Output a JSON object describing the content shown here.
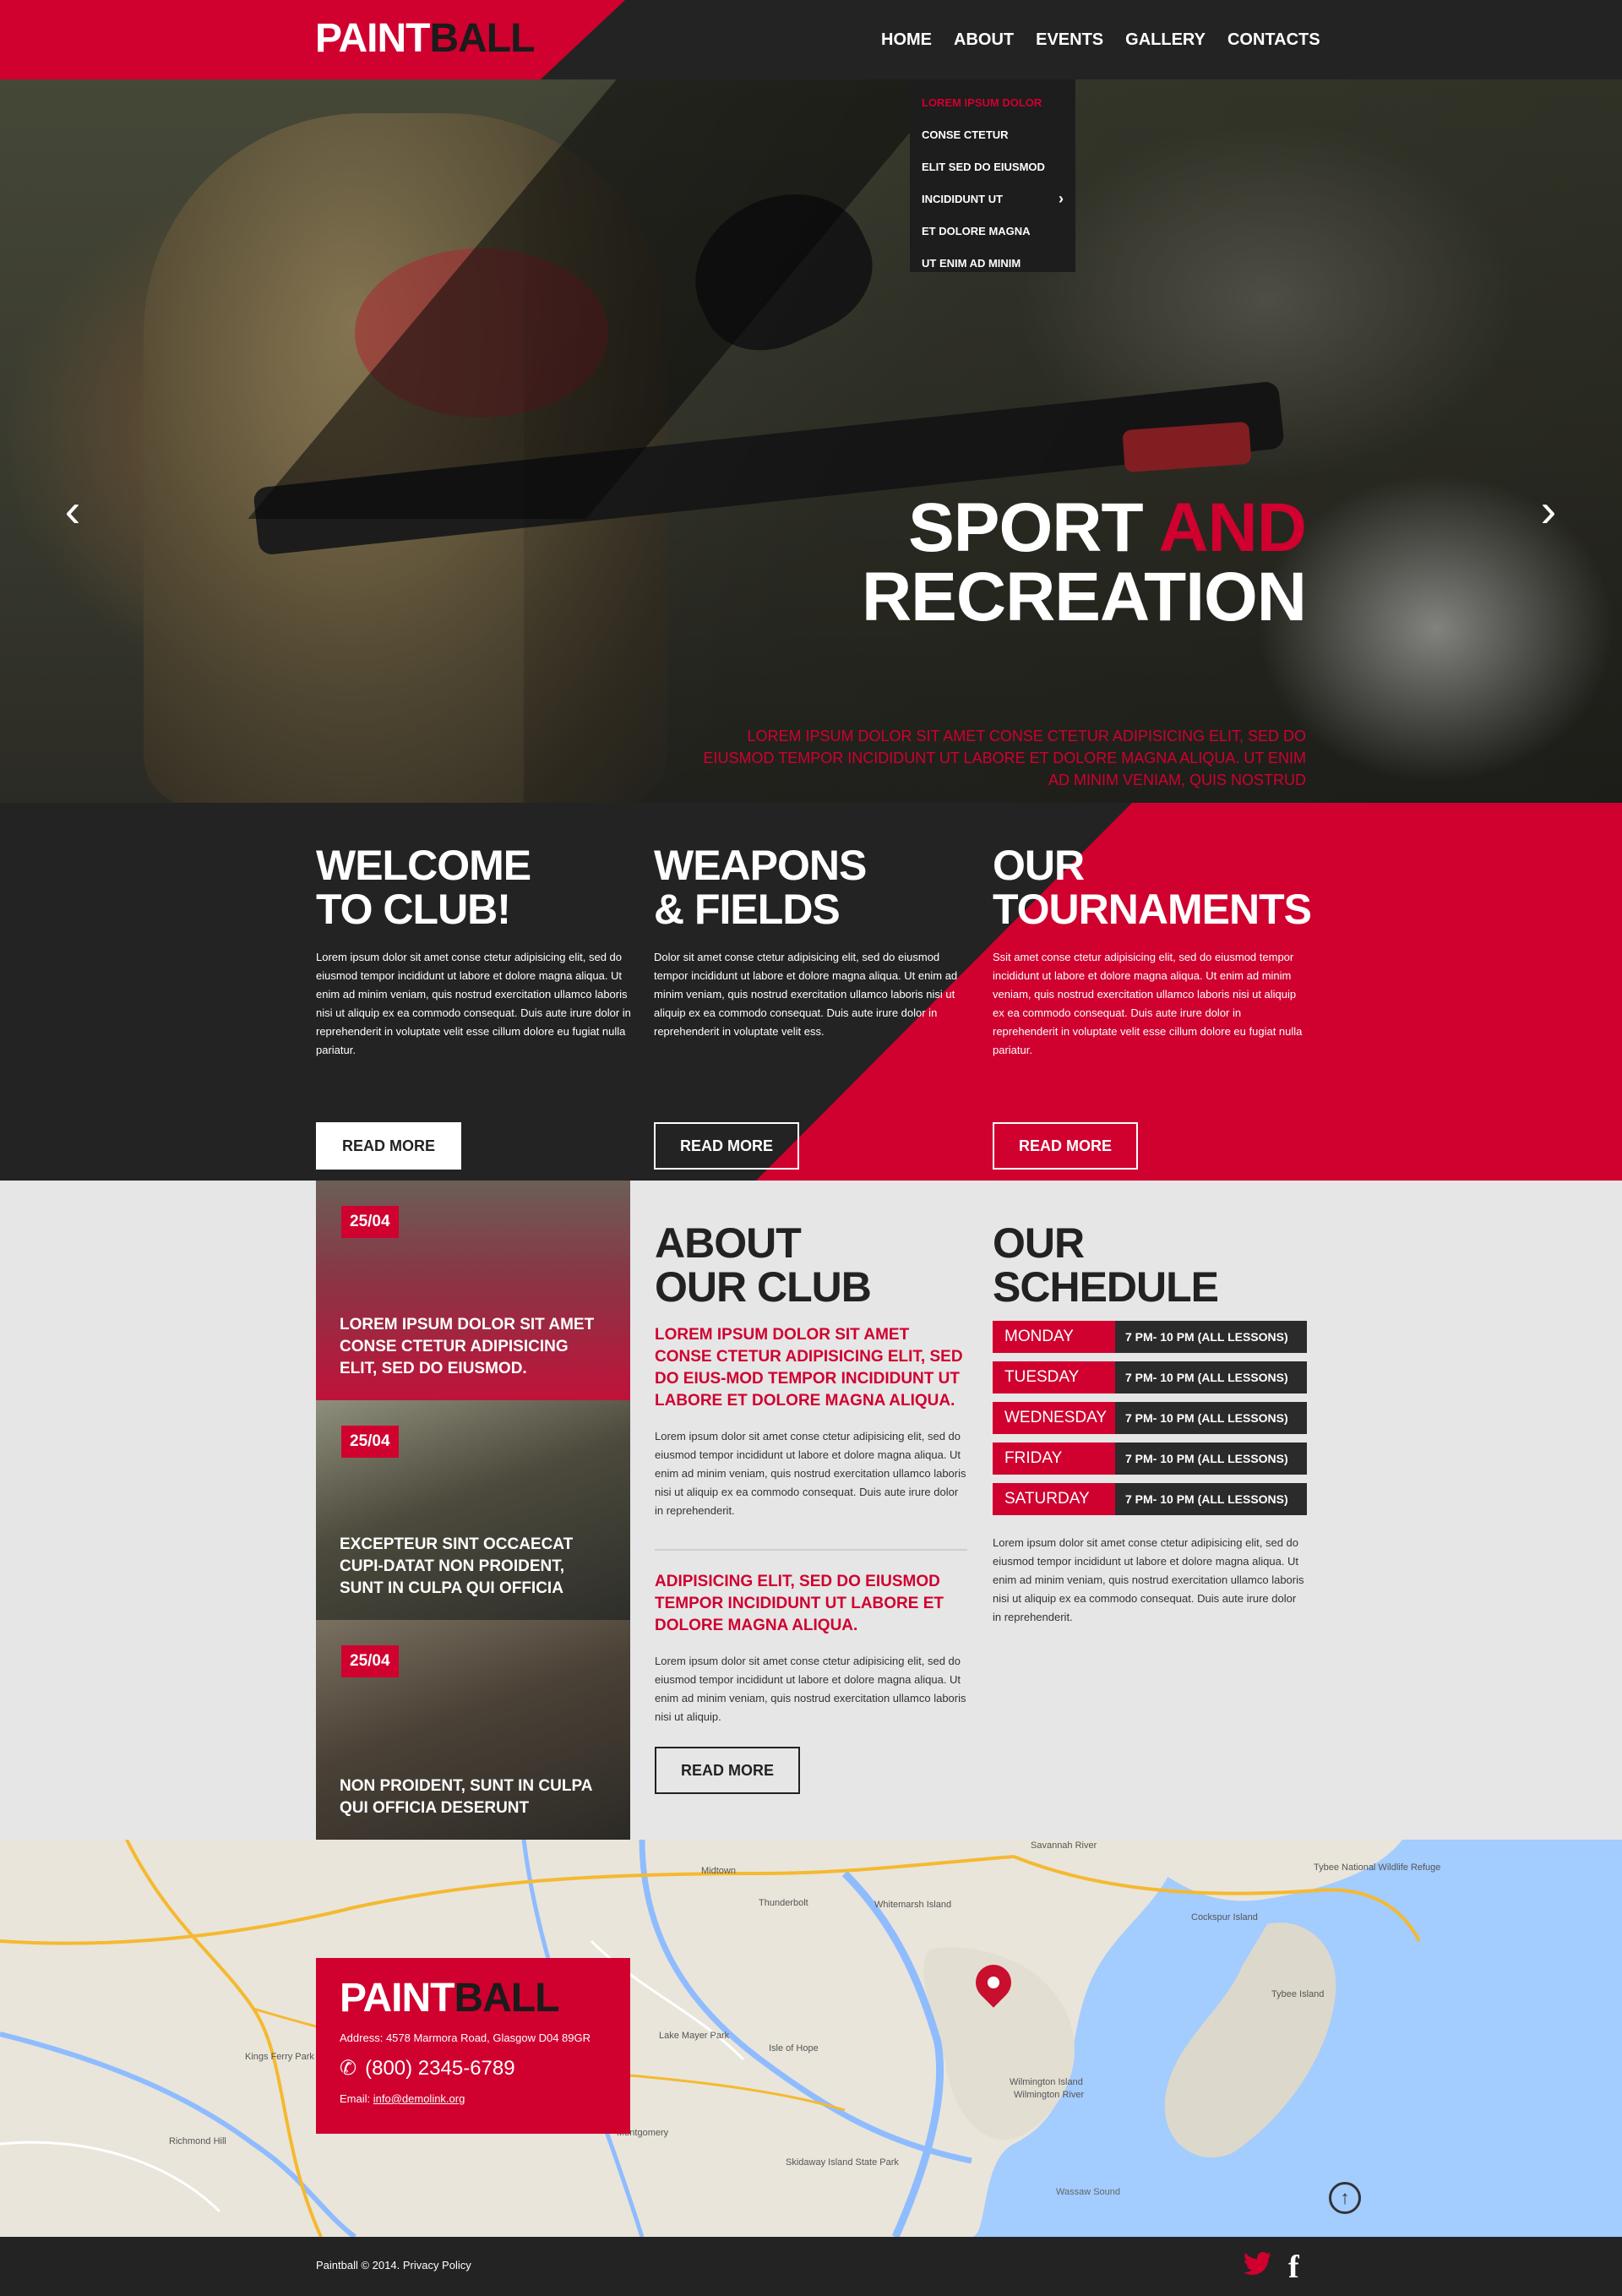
{
  "header": {
    "logo_part1": "PAINT",
    "logo_part2": "BALL",
    "nav": [
      "HOME",
      "ABOUT",
      "EVENTS",
      "GALLERY",
      "CONTACTS"
    ]
  },
  "dropdown": {
    "items": [
      "LOREM IPSUM DOLOR",
      "CONSE CTETUR",
      "ELIT SED DO EIUSMOD",
      "INCIDIDUNT UT",
      "ET DOLORE MAGNA",
      "UT ENIM AD MINIM"
    ],
    "submenu_arrow": "›"
  },
  "hero": {
    "title_part1": "SPORT",
    "title_part2": "AND",
    "title_line2": "RECREATION",
    "subtitle": "LOREM IPSUM DOLOR SIT AMET CONSE CTETUR ADIPISICING ELIT, SED DO EIUSMOD TEMPOR INCIDIDUNT UT LABORE ET DOLORE MAGNA ALIQUA. UT ENIM AD MINIM VENIAM, QUIS NOSTRUD",
    "prev_arrow": "‹",
    "next_arrow": "›"
  },
  "features": [
    {
      "title_l1": "WELCOME",
      "title_l2": "TO CLUB!",
      "text": "Lorem ipsum dolor sit amet conse ctetur adipisicing elit, sed do eiusmod tempor incididunt ut labore et dolore magna aliqua. Ut enim ad minim veniam, quis nostrud exercitation ullamco laboris nisi ut aliquip ex ea commodo consequat. Duis aute irure dolor in reprehenderit in voluptate velit esse cillum dolore eu fugiat nulla pariatur.",
      "button": "READ MORE"
    },
    {
      "title_l1": "WEAPONS",
      "title_l2": "& FIELDS",
      "text": "Dolor sit amet conse ctetur adipisicing elit, sed do eiusmod tempor incididunt ut labore et dolore magna aliqua. Ut enim ad minim veniam, quis nostrud exercitation ullamco laboris nisi ut aliquip ex ea commodo consequat. Duis aute irure dolor in reprehenderit in voluptate velit ess.",
      "button": "READ MORE"
    },
    {
      "title_l1": "OUR",
      "title_l2": "TOURNAMENTS",
      "text": "Ssit amet conse ctetur adipisicing elit, sed do eiusmod tempor incididunt ut labore et dolore magna aliqua. Ut enim ad minim veniam, quis nostrud exercitation ullamco laboris nisi ut aliquip ex ea commodo consequat. Duis aute irure dolor in reprehenderit in voluptate velit esse cillum dolore eu fugiat nulla pariatur.",
      "button": "READ MORE"
    }
  ],
  "news": [
    {
      "date": "25/04",
      "title": "LOREM IPSUM DOLOR SIT AMET CONSE CTETUR ADIPISICING ELIT, SED DO EIUSMOD."
    },
    {
      "date": "25/04",
      "title": "EXCEPTEUR SINT OCCAECAT CUPI-DATAT NON PROIDENT, SUNT IN CULPA QUI OFFICIA"
    },
    {
      "date": "25/04",
      "title": "NON PROIDENT, SUNT IN CULPA QUI OFFICIA DESERUNT"
    }
  ],
  "about": {
    "title_l1": "ABOUT",
    "title_l2": "OUR CLUB",
    "highlight1": "LOREM IPSUM DOLOR SIT AMET CONSE CTETUR ADIPISICING ELIT, SED DO EIUS-MOD TEMPOR INCIDIDUNT UT LABORE ET DOLORE MAGNA ALIQUA.",
    "text1": "Lorem ipsum dolor sit amet conse ctetur adipisicing elit, sed do eiusmod tempor incididunt ut labore et dolore magna aliqua. Ut enim ad minim veniam, quis nostrud exercitation ullamco laboris nisi ut aliquip ex ea commodo consequat. Duis aute irure dolor in reprehenderit.",
    "highlight2": "ADIPISICING ELIT, SED DO EIUSMOD TEMPOR INCIDIDUNT UT LABORE ET DOLORE MAGNA ALIQUA.",
    "text2": "Lorem ipsum dolor sit amet conse ctetur adipisicing elit, sed do eiusmod tempor incididunt ut labore et dolore magna aliqua. Ut enim ad minim veniam, quis nostrud exercitation ullamco laboris nisi ut aliquip.",
    "button": "READ MORE"
  },
  "schedule": {
    "title_l1": "OUR",
    "title_l2": "SCHEDULE",
    "rows": [
      {
        "day": "MONDAY",
        "time": "7 PM- 10 PM (ALL LESSONS)"
      },
      {
        "day": "TUESDAY",
        "time": "7 PM- 10 PM (ALL LESSONS)"
      },
      {
        "day": "WEDNESDAY",
        "time": "7 PM- 10 PM (ALL LESSONS)"
      },
      {
        "day": "FRIDAY",
        "time": "7 PM- 10 PM (ALL LESSONS)"
      },
      {
        "day": "SATURDAY",
        "time": "7 PM- 10 PM (ALL LESSONS)"
      }
    ],
    "text": "Lorem ipsum dolor sit amet conse ctetur adipisicing elit, sed do eiusmod tempor incididunt ut labore et dolore magna aliqua. Ut enim ad minim veniam, quis nostrud exercitation ullamco laboris nisi ut aliquip ex ea commodo consequat. Duis aute irure dolor in reprehenderit."
  },
  "contact": {
    "logo_part1": "PAINT",
    "logo_part2": "BALL",
    "address_label": "Address:",
    "address": "4578 Marmora Road, Glasgow D04 89GR",
    "phone": "(800) 2345-6789",
    "email_label": "Email:",
    "email": "info@demolink.org"
  },
  "map": {
    "labels": [
      "Thunderbolt",
      "Whitemarsh Island",
      "Wilmington Island",
      "Skidaway Island State Park",
      "Tybee Island",
      "Tybee National Wildlife Refuge",
      "Cockspur Island",
      "Isle of Hope",
      "Montgomery",
      "Wassaw Sound",
      "Midtown",
      "Lake Mayer Park",
      "Kings Ferry Park",
      "Richmond Hill",
      "Wilmington River",
      "Savannah River"
    ]
  },
  "footer": {
    "copyright": "Paintball © 2014.",
    "privacy": "Privacy Policy",
    "to_top": "↑"
  },
  "colors": {
    "accent": "#d0002f",
    "dark": "#232323",
    "light": "#e6e6e6"
  }
}
